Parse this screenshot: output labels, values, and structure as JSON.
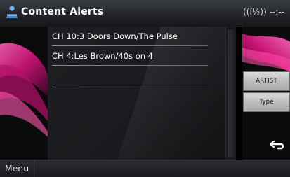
{
  "header": {
    "title": "Content Alerts",
    "signal_text": "((ᴵᵋ)) ----",
    "signal_glyph": "((í½))",
    "status": "--:--"
  },
  "list": {
    "items": [
      {
        "label": "CH 10:3 Doors Down/The Pulse"
      },
      {
        "label": "CH 4:Les Brown/40s on 4"
      },
      {
        "label": ""
      }
    ]
  },
  "side_buttons": {
    "artist_label": "ARTIST",
    "type_label": "Type"
  },
  "footer": {
    "menu_label": "Menu"
  },
  "colors": {
    "accent_pink": "#d2147a",
    "panel_dark": "#1a1b1e",
    "text": "#ffffff"
  },
  "icons": {
    "app": "person-alert-icon",
    "back": "back-arrow-icon",
    "signal": "signal-icon"
  }
}
